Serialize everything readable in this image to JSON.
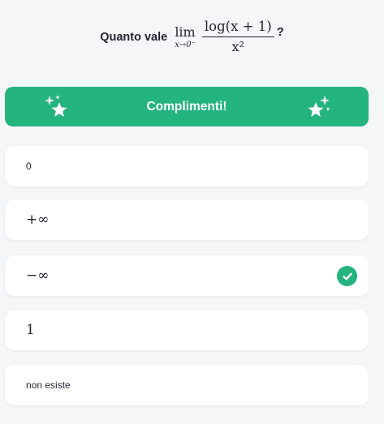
{
  "question": {
    "prefix": "Quanto vale",
    "lim_word": "lim",
    "lim_sub": "x→0⁻",
    "numerator": "log(x + 1)",
    "denominator": "x²",
    "suffix": "?"
  },
  "banner": {
    "text": "Complimenti!",
    "color": "#24b47e",
    "icon": "sparkle-star-icon"
  },
  "options": [
    {
      "label": "0",
      "style": "text",
      "selected_correct": false
    },
    {
      "label": "+∞",
      "style": "math",
      "selected_correct": false
    },
    {
      "label": "−∞",
      "style": "math",
      "selected_correct": true,
      "icon": "check-circle-icon"
    },
    {
      "label": "1",
      "style": "math",
      "selected_correct": false
    },
    {
      "label": "non esiste",
      "style": "text",
      "selected_correct": false
    }
  ]
}
